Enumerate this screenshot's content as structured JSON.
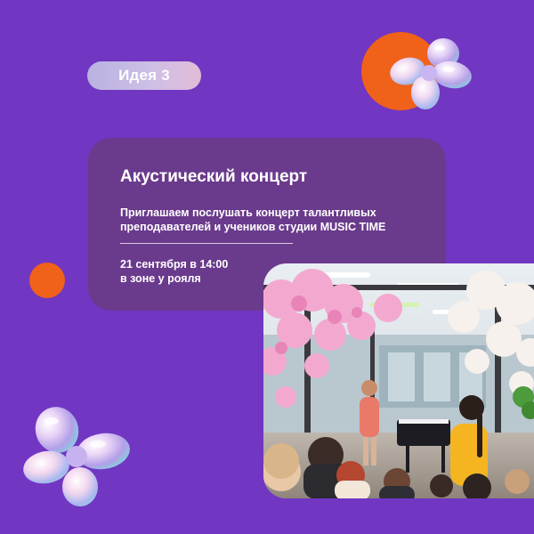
{
  "badge": {
    "label": "Идея 3"
  },
  "event": {
    "title": "Акустический концерт",
    "description_lines": [
      "Приглашаем послушать концерт талантливых",
      "преподавателей и учеников студии MUSIC TIME"
    ],
    "date_line": "21 сентября в 14:00",
    "location_line": "в зоне у рояля"
  },
  "colors": {
    "background": "#7136c2",
    "accent_orange": "#f0611a",
    "card": "#6a3a8c",
    "badge_gradient": [
      "#b9b2e0",
      "#e2bcd8"
    ]
  },
  "decorations": {
    "balloon_flowers": [
      "balloon-flower-icon",
      "balloon-flower-icon"
    ],
    "photo_subject": "concert-photo"
  }
}
